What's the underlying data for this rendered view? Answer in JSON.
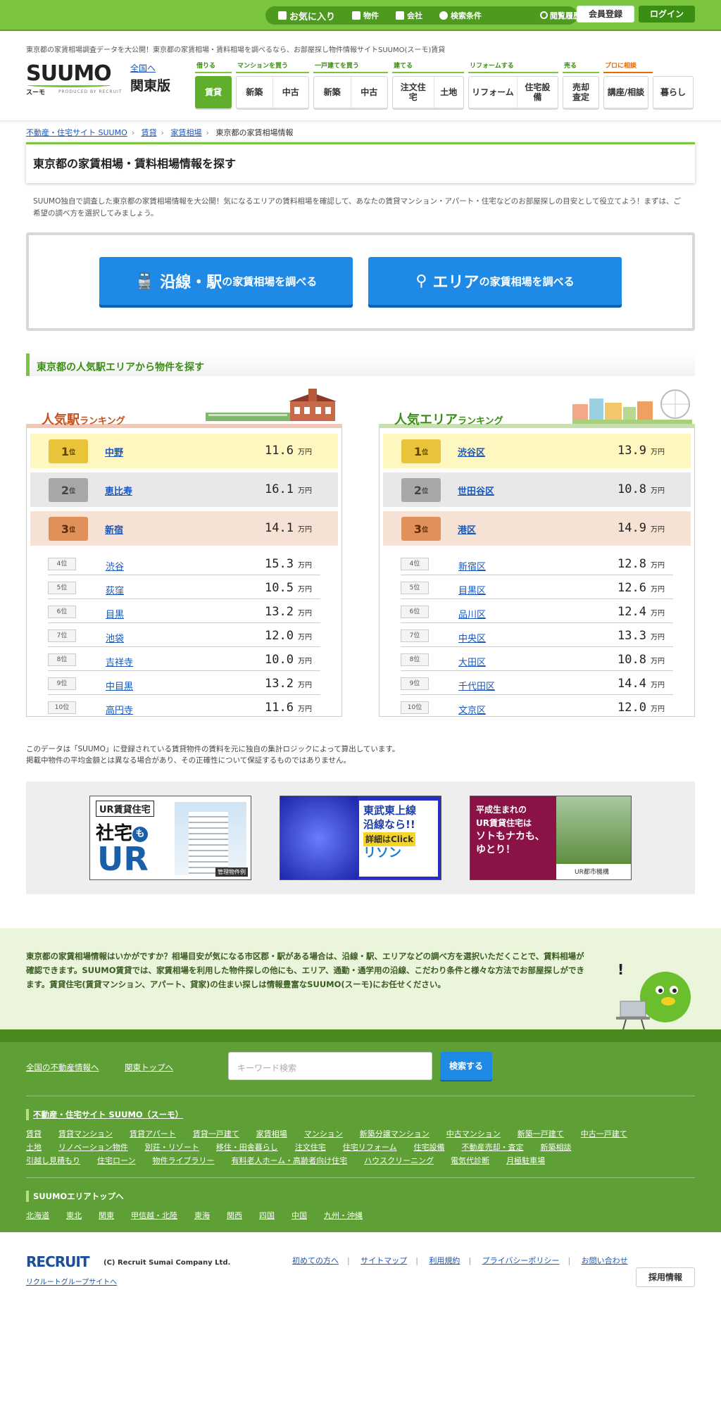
{
  "topnav": {
    "favorite": "お気に入り",
    "property": "物件",
    "company": "会社",
    "conditions": "検索条件",
    "history": "閲覧履歴",
    "member": "会員登録",
    "login": "ログイン"
  },
  "header": {
    "tagline": "東京都の家賃相場調査データを大公開！東京都の家賃相場・賃料相場を調べるなら、お部屋探し物件情報サイトSUUMO(スーモ)賃貸",
    "logo_word": "SUUMO",
    "logo_sub": "スーモ",
    "logo_pby": "PRODUCED BY RECRUIT",
    "zenkoku": "全国へ",
    "region": "関東版",
    "categories": [
      {
        "label": "借りる"
      },
      {
        "label": "マンションを買う"
      },
      {
        "label": "一戸建てを買う"
      },
      {
        "label": "建てる"
      },
      {
        "label": "リフォームする"
      },
      {
        "label": "売る"
      },
      {
        "label": "プロに相談"
      }
    ],
    "nav": {
      "chintai": "賃貸",
      "mansion_new": "新築",
      "mansion_used": "中古",
      "house_new": "新築",
      "house_used": "中古",
      "chumon": "注文住宅",
      "tochi": "土地",
      "reform": "リフォーム",
      "jutaku_setsubi": "住宅設備",
      "baikyaku": "売却査定",
      "kouza": "講座/相談",
      "kurashi": "暮らし"
    }
  },
  "breadcrumb": {
    "home": "不動産・住宅サイト SUUMO",
    "chintai": "賃貸",
    "souba": "家賃相場",
    "current": "東京都の家賃相場情報"
  },
  "page_title": "東京都の家賃相場・賃料相場情報を探す",
  "lead": "SUUMO独自で調査した東京都の家賃相場情報を大公開！気になるエリアの賃料相場を確認して、あなたの賃貸マンション・アパート・住宅などのお部屋探しの目安として役立てよう！まずは、ご希望の調べ方を選択してみましょう。",
  "search_buttons": {
    "line_big": "沿線・駅",
    "line_small": "の家賃相場を調べる",
    "area_big": "エリア",
    "area_small": "の家賃相場を調べる"
  },
  "section_heading": "東京都の人気駅エリアから物件を探す",
  "unit": "万円",
  "station_ranking": {
    "title_big": "人気駅",
    "title_small": "ランキング",
    "items": [
      {
        "rank": "1",
        "rank_suffix": "位",
        "name": "中野",
        "price": "11.6"
      },
      {
        "rank": "2",
        "rank_suffix": "位",
        "name": "恵比寿",
        "price": "16.1"
      },
      {
        "rank": "3",
        "rank_suffix": "位",
        "name": "新宿",
        "price": "14.1"
      },
      {
        "rank": "4位",
        "name": "渋谷",
        "price": "15.3"
      },
      {
        "rank": "5位",
        "name": "荻窪",
        "price": "10.5"
      },
      {
        "rank": "6位",
        "name": "目黒",
        "price": "13.2"
      },
      {
        "rank": "7位",
        "name": "池袋",
        "price": "12.0"
      },
      {
        "rank": "8位",
        "name": "吉祥寺",
        "price": "10.0"
      },
      {
        "rank": "9位",
        "name": "中目黒",
        "price": "13.2"
      },
      {
        "rank": "10位",
        "name": "高円寺",
        "price": "11.6"
      }
    ]
  },
  "area_ranking": {
    "title_big": "人気エリア",
    "title_small": "ランキング",
    "items": [
      {
        "rank": "1",
        "rank_suffix": "位",
        "name": "渋谷区",
        "price": "13.9"
      },
      {
        "rank": "2",
        "rank_suffix": "位",
        "name": "世田谷区",
        "price": "10.8"
      },
      {
        "rank": "3",
        "rank_suffix": "位",
        "name": "港区",
        "price": "14.9"
      },
      {
        "rank": "4位",
        "name": "新宿区",
        "price": "12.8"
      },
      {
        "rank": "5位",
        "name": "目黒区",
        "price": "12.6"
      },
      {
        "rank": "6位",
        "name": "品川区",
        "price": "12.4"
      },
      {
        "rank": "7位",
        "name": "中央区",
        "price": "13.3"
      },
      {
        "rank": "8位",
        "name": "大田区",
        "price": "10.8"
      },
      {
        "rank": "9位",
        "name": "千代田区",
        "price": "14.4"
      },
      {
        "rank": "10位",
        "name": "文京区",
        "price": "12.0"
      }
    ]
  },
  "note_line1": "このデータは「SUUMO」に登録されている賃貸物件の賃料を元に独自の集計ロジックによって算出しています。",
  "note_line2": "掲載中物件の平均金額とは異なる場合があり、その正確性について保証するものではありません。",
  "banners": {
    "b1_top": "UR賃貸住宅",
    "b1_main": "社宅",
    "b1_mo": "も",
    "b1_ur": "UR",
    "b1_tag": "管理物件例",
    "b2_l1": "東武東上線",
    "b2_l2": "沿線なら!!",
    "b2_l3": "詳細はClick",
    "b2_brand": "リソン",
    "b3_l1": "平成生まれの",
    "b3_l2": "UR賃貸住宅は",
    "b3_l3": "ソトもナカも、",
    "b3_l4": "ゆとり！",
    "b3_brand": "UR都市機構"
  },
  "message": "東京都の家賃相場情報はいかがですか？相場目安が気になる市区郡・駅がある場合は、沿線・駅、エリアなどの調べ方を選択いただくことで、賃料相場が確認できます。SUUMO賃貸では、家賃相場を利用した物件探しの他にも、エリア、通勤・通学用の沿線、こだわり条件と様々な方法でお部屋探しができます。賃貸住宅(賃貸マンション、アパート、貸家)の住まい探しは情報豊富なSUUMO(スーモ)にお任せください。",
  "footer": {
    "link_zenkoku": "全国の不動産情報へ",
    "link_kanto": "関東トップへ",
    "search_placeholder": "キーワード検索",
    "search_button": "検索する",
    "site_heading": "不動産・住宅サイト SUUMO（スーモ）",
    "site_links": [
      "賃貸",
      "賃貸マンション",
      "賃貸アパート",
      "賃貸一戸建て",
      "家賃相場",
      "マンション",
      "新築分譲マンション",
      "中古マンション",
      "新築一戸建て",
      "中古一戸建て",
      "土地",
      "リノベーション物件",
      "別荘・リゾート",
      "移住・田舎暮らし",
      "注文住宅",
      "住宅リフォーム",
      "住宅設備",
      "不動産売却・査定",
      "新築相談",
      "引越し見積もり",
      "住宅ローン",
      "物件ライブラリー",
      "有料老人ホーム・高齢者向け住宅",
      "ハウスクリーニング",
      "電気代診断",
      "月極駐車場"
    ],
    "area_heading": "SUUMOエリアトップへ",
    "area_links": [
      "北海道",
      "東北",
      "関東",
      "甲信越・北陸",
      "東海",
      "関西",
      "四国",
      "中国",
      "九州・沖縄"
    ]
  },
  "bottom": {
    "recruit": "RECRUIT",
    "copyright": "(C) Recruit Sumai Company Ltd.",
    "group": "リクルートグループサイトへ",
    "links": [
      "初めての方へ",
      "サイトマップ",
      "利用規約",
      "プライバシーポリシー",
      "お問い合わせ"
    ],
    "saiyo": "採用情報"
  }
}
